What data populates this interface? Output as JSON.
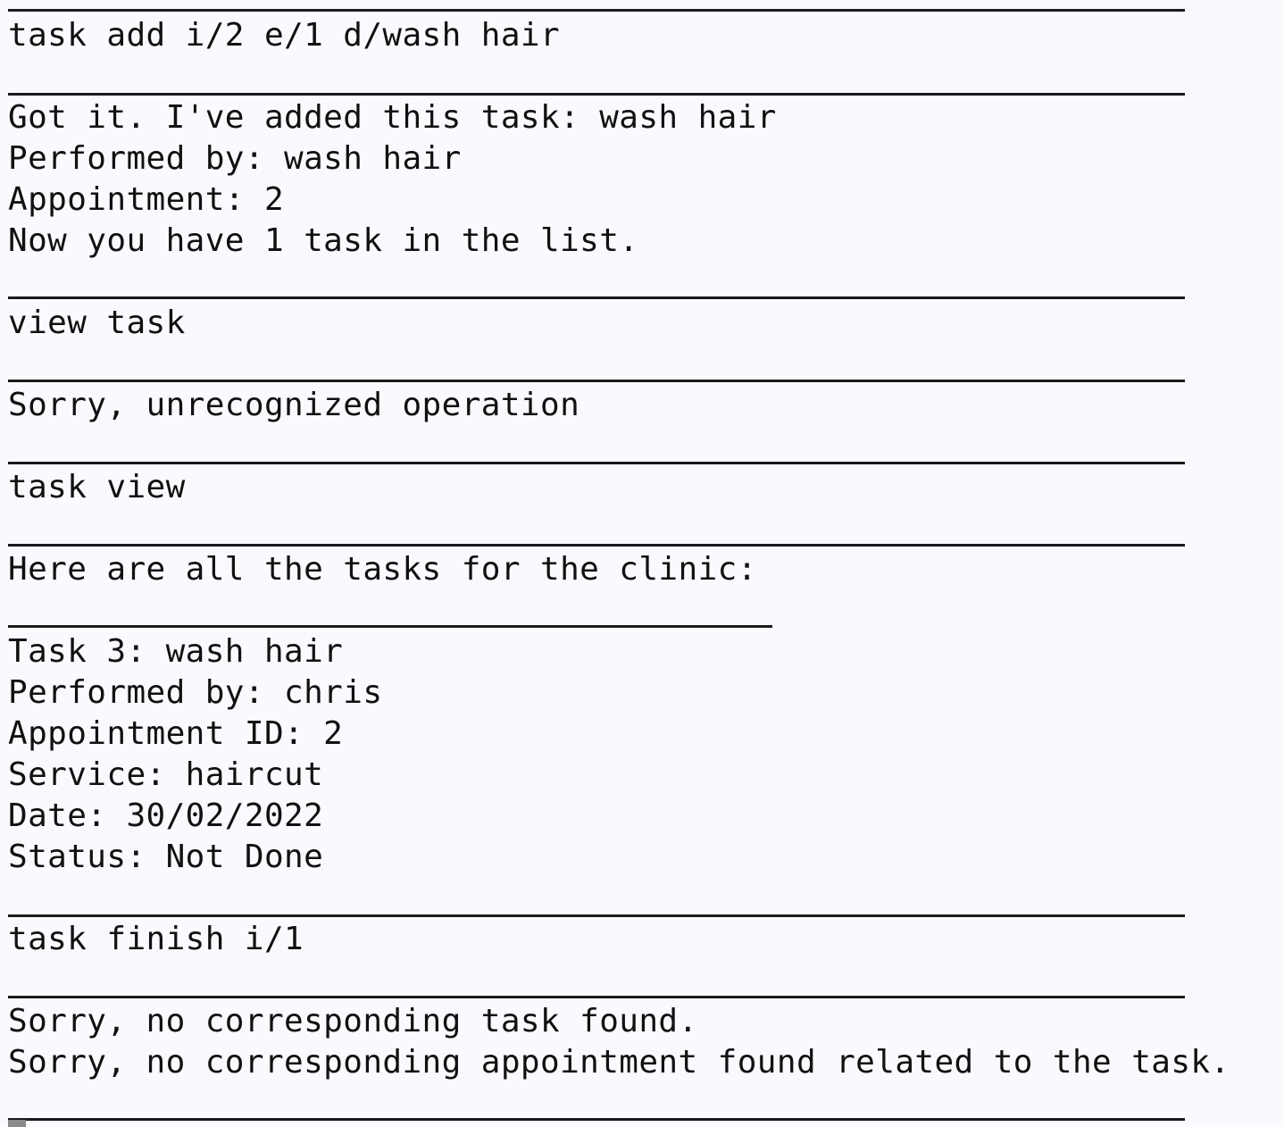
{
  "terminal": {
    "lines": [
      "task add i/2 e/1 d/wash hair",
      "Got it. I've added this task: wash hair",
      "Performed by: wash hair",
      "Appointment: 2",
      "Now you have 1 task in the list.",
      "view task",
      "Sorry, unrecognized operation",
      "task view",
      "Here are all the tasks for the clinic:",
      "Task 3: wash hair",
      "Performed by: chris",
      "Appointment ID: 2",
      "Service: haircut",
      "Date: 30/02/2022",
      "Status: Not Done",
      "task finish i/1",
      "Sorry, no corresponding task found.",
      "Sorry, no corresponding appointment found related to the task."
    ]
  }
}
